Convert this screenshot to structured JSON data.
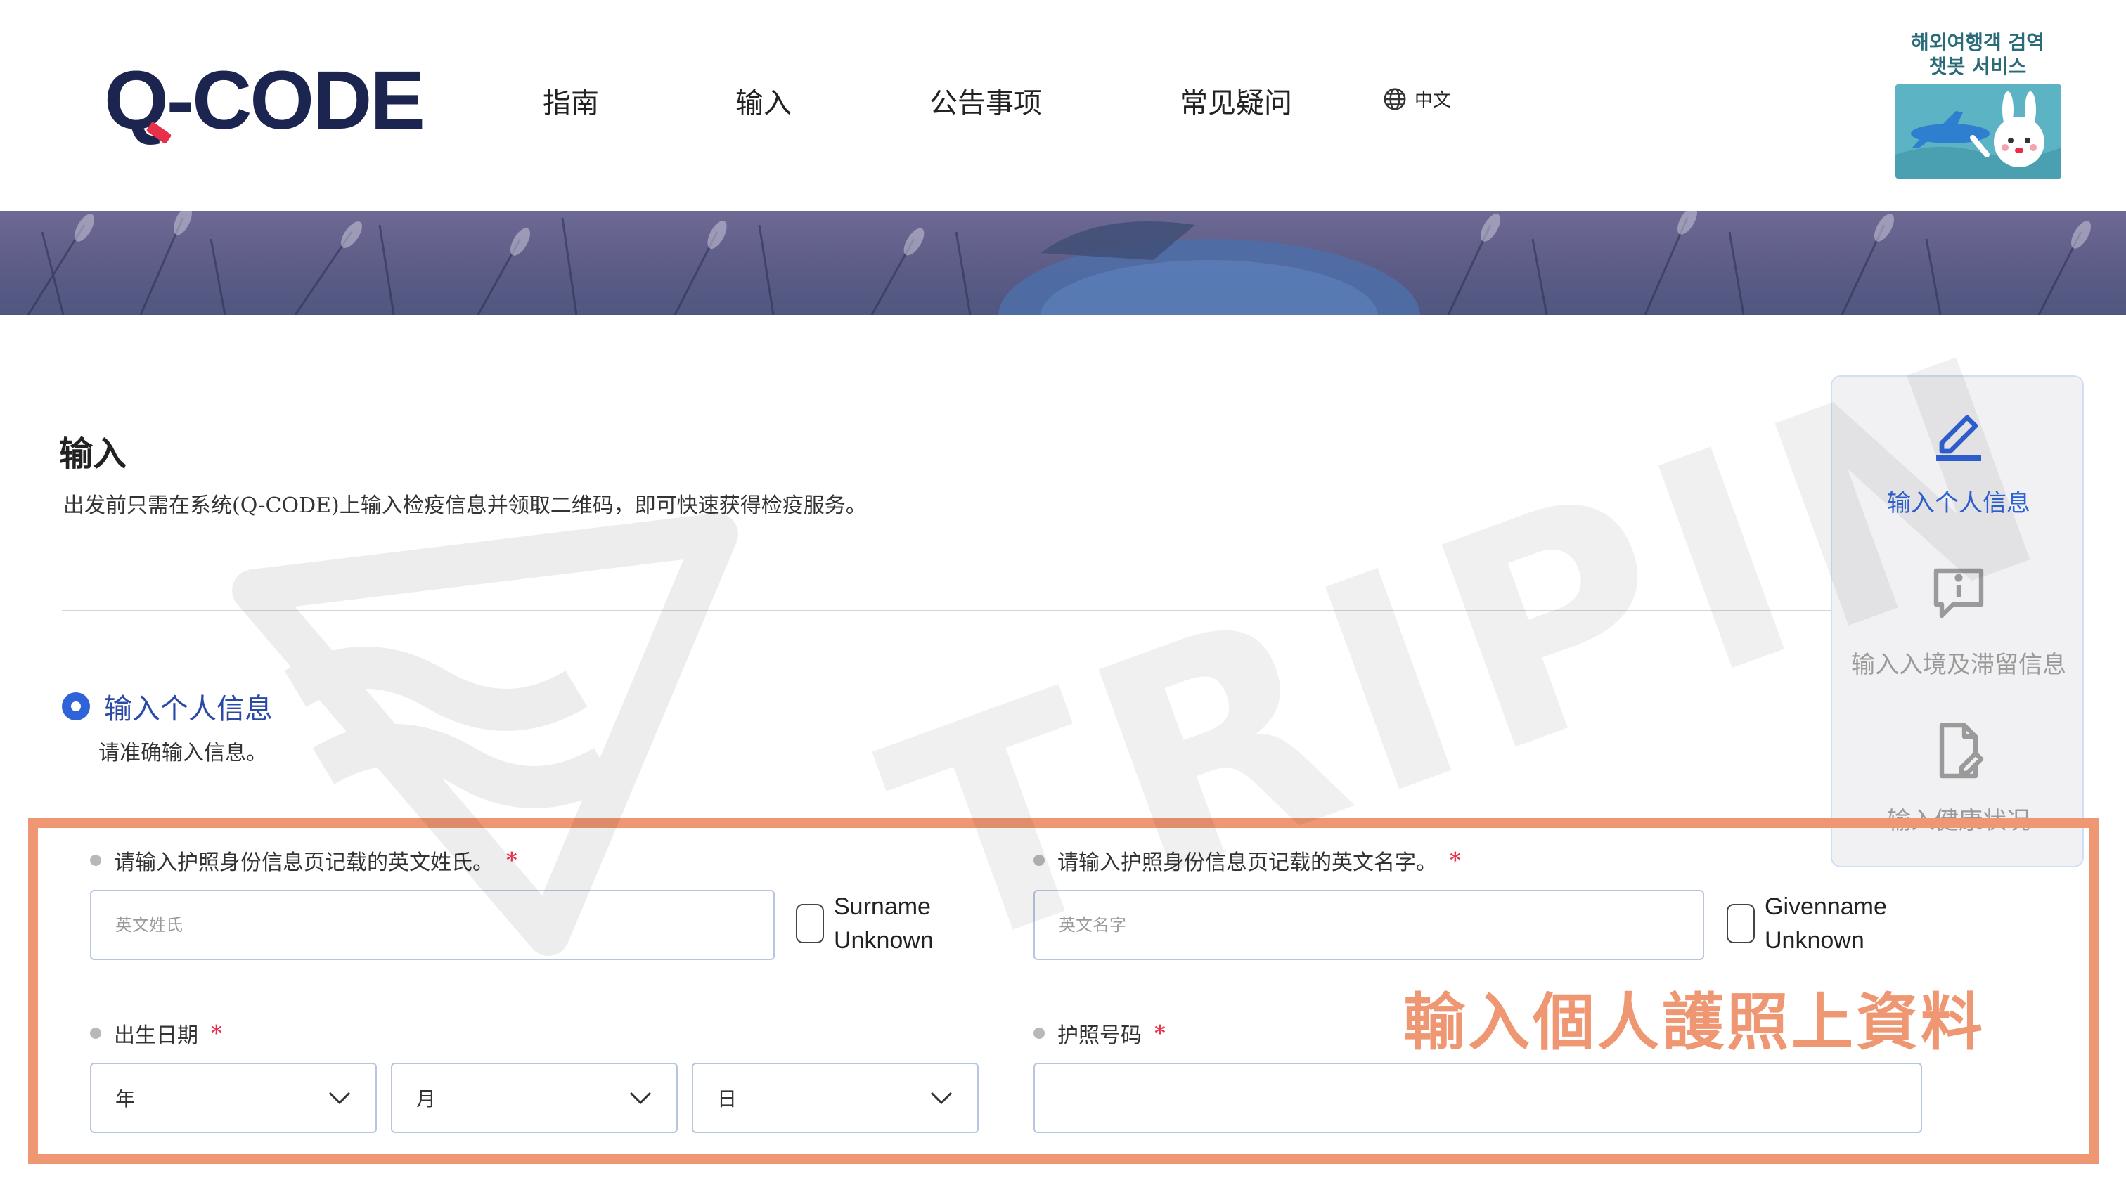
{
  "header": {
    "logo_q": "Q",
    "logo_rest": "-CODE",
    "nav": [
      {
        "label": "指南"
      },
      {
        "label": "输入"
      },
      {
        "label": "公告事项"
      },
      {
        "label": "常见疑问"
      }
    ],
    "language": "中文",
    "chatbot_line1": "해외여행객 검역",
    "chatbot_line2": "챗봇 서비스"
  },
  "watermark": "TRIPIN",
  "main": {
    "title": "输入",
    "description": "出发前只需在系统(Q-CODE)上输入检疫信息并领取二维码，即可快速获得检疫服务。",
    "section_title": "输入个人信息",
    "section_subtitle": "请准确输入信息。"
  },
  "side_panel": {
    "steps": [
      {
        "label": "输入个人信息",
        "icon": "pencil-icon",
        "active": true
      },
      {
        "label": "输入入境及滞留信息",
        "icon": "info-message-icon",
        "active": false
      },
      {
        "label": "输入健康状况",
        "icon": "document-edit-icon",
        "active": false
      }
    ],
    "active_color": "#2f63d8",
    "inactive_color": "#9a9a9a"
  },
  "form": {
    "surname": {
      "label": "请输入护照身份信息页记载的英文姓氏。",
      "required": "*",
      "placeholder": "英文姓氏",
      "unknown_line1": "Surname",
      "unknown_line2": "Unknown"
    },
    "givenname": {
      "label": "请输入护照身份信息页记载的英文名字。",
      "required": "*",
      "placeholder": "英文名字",
      "unknown_line1": "Givenname",
      "unknown_line2": "Unknown"
    },
    "birthdate": {
      "label": "出生日期",
      "required": "*",
      "year": "年",
      "month": "月",
      "day": "日"
    },
    "passport": {
      "label": "护照号码",
      "required": "*"
    }
  },
  "annotation": "輸入個人護照上資料",
  "colors": {
    "brand_navy": "#1b2550",
    "accent_red": "#e8304a",
    "highlight_orange": "#ef9672",
    "primary_blue": "#2f63d8"
  }
}
